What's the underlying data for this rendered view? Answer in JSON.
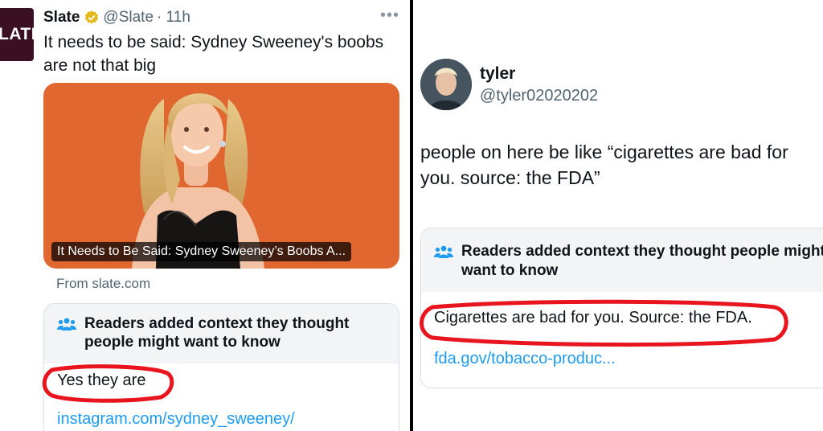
{
  "left_tweet": {
    "avatar_label": "LATE",
    "name": "Slate",
    "handle": "@Slate",
    "time": "· 11h",
    "text": "It needs to be said: Sydney Sweeney's boobs are not that big",
    "media_caption": "It Needs to Be Said: Sydney Sweeney’s Boobs A...",
    "source": "From slate.com",
    "note": {
      "header": "Readers added context they thought people might want to know",
      "text": "Yes they are",
      "link": "instagram.com/sydney_sweeney/"
    }
  },
  "right_tweet": {
    "name": "tyler",
    "handle": "@tyler02020202",
    "text": "people on here be like “cigarettes are bad for you. source: the FDA”",
    "note": {
      "header": "Readers added context they thought people might want to know",
      "text": "Cigarettes are bad for you. Source: the FDA.",
      "link": "fda.gov/tobacco-produc..."
    }
  },
  "colors": {
    "link": "#1d9bf0",
    "handle_gray": "#536471",
    "verified_gold": "#e2b719",
    "annotation_red": "#e8151f",
    "media_orange": "#e0672f"
  },
  "icons": [
    "verified-badge-icon",
    "more-options-icon",
    "readers-group-icon"
  ]
}
